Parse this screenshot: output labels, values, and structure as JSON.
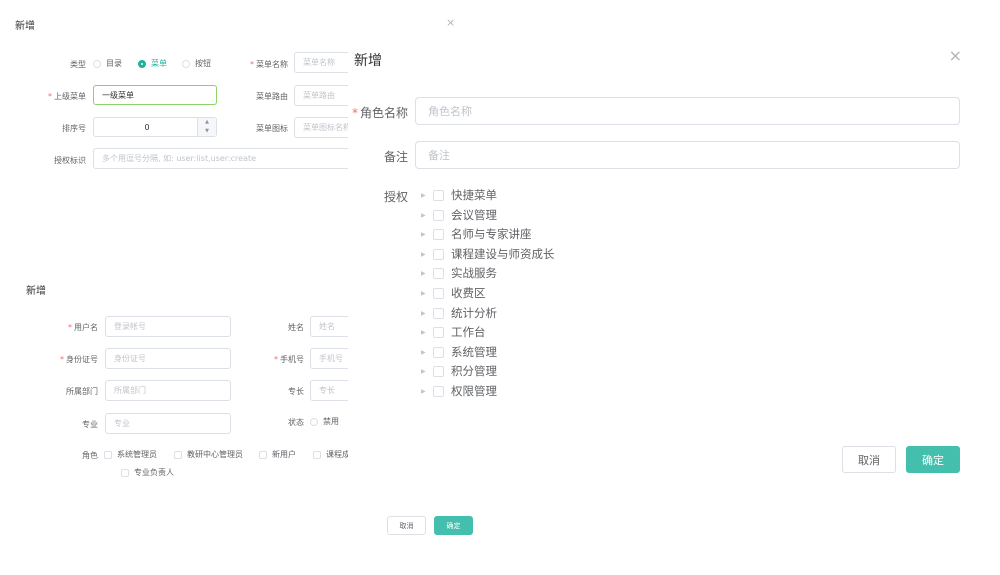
{
  "menu_dialog": {
    "title": "新增",
    "close_icon": "×",
    "type_label": "类型",
    "type_options": [
      "目录",
      "菜单",
      "按钮"
    ],
    "type_selected": "菜单",
    "menu_name_label": "菜单名称",
    "menu_name_placeholder": "菜单名称",
    "parent_label": "上级菜单",
    "parent_value": "一级菜单",
    "route_label": "菜单路由",
    "route_placeholder": "菜单路由",
    "order_label": "排序号",
    "order_value": "0",
    "icon_label": "菜单图标",
    "icon_placeholder": "菜单图标名称",
    "perm_label": "授权标识",
    "perm_placeholder": "多个用逗号分隔, 如: user:list,user:create",
    "cancel": "取消",
    "confirm": "确定"
  },
  "user_dialog": {
    "title": "新增",
    "username_label": "用户名",
    "username_placeholder": "登录帐号",
    "name_label": "姓名",
    "name_placeholder": "姓名",
    "idcard_label": "身份证号",
    "idcard_placeholder": "身份证号",
    "phone_label": "手机号",
    "phone_placeholder": "手机号",
    "dept_label": "所属部门",
    "dept_placeholder": "所属部门",
    "specialty_label": "专长",
    "specialty_placeholder": "专长",
    "major_label": "专业",
    "major_placeholder": "专业",
    "status_label": "状态",
    "status_option": "禁用",
    "role_label": "角色",
    "roles": [
      "系统管理员",
      "教研中心管理员",
      "新用户",
      "课程成",
      "专业负责人"
    ]
  },
  "role_dialog": {
    "title": "新增",
    "close_icon": "×",
    "role_name_label": "角色名称",
    "role_name_placeholder": "角色名称",
    "remark_label": "备注",
    "remark_placeholder": "备注",
    "auth_label": "授权",
    "tree": [
      "快捷菜单",
      "会议管理",
      "名师与专家讲座",
      "课程建设与师资成长",
      "实战服务",
      "收费区",
      "统计分析",
      "工作台",
      "系统管理",
      "积分管理",
      "权限管理"
    ],
    "cancel": "取消",
    "confirm": "确定"
  },
  "colors": {
    "accent": "#44bfae",
    "radio_on": "#1fb19e",
    "required": "#f56c6c"
  }
}
